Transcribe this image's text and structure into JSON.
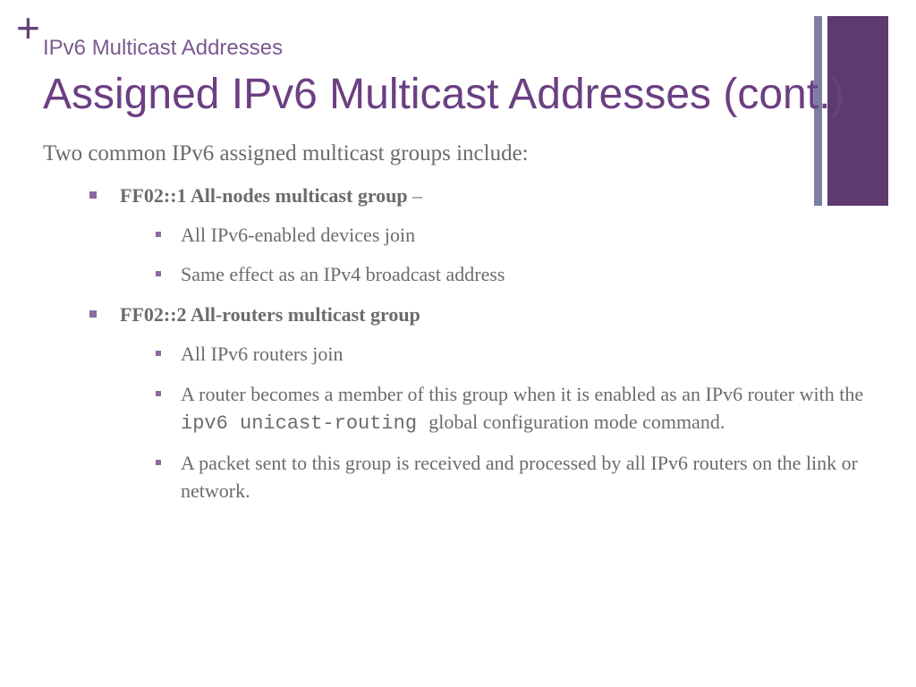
{
  "plus": "+",
  "subtitle": "IPv6 Multicast Addresses",
  "title": "Assigned IPv6 Multicast Addresses (cont.)",
  "intro": "Two common IPv6 assigned multicast groups include:",
  "groups": [
    {
      "label": "FF02::1 All-nodes multicast group",
      "suffix": " –",
      "sub": [
        "All IPv6-enabled devices join",
        "Same effect as an IPv4 broadcast address"
      ]
    },
    {
      "label": "FF02::2 All-routers multicast group",
      "suffix": "",
      "sub": [
        "All IPv6 routers join",
        "A router becomes a member of this group when it is enabled as an IPv6 router with the ipv6 unicast-routing global configuration mode command.",
        "A packet sent to this group is received and processed by all IPv6 routers on the link or network."
      ]
    }
  ],
  "mono_phrase": "ipv6 unicast-routing"
}
